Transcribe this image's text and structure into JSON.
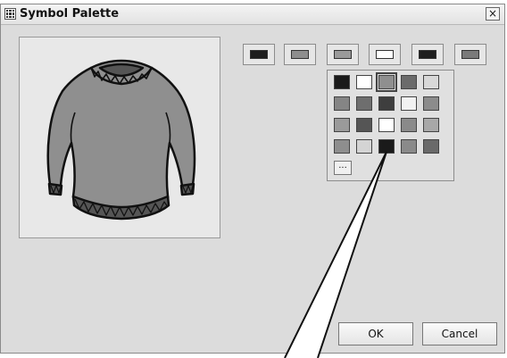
{
  "window": {
    "title": "Symbol Palette",
    "close_label": "×"
  },
  "icons": {
    "app": "grid-icon",
    "close": "close-icon"
  },
  "color_buttons": [
    {
      "color": "#1e1e1e"
    },
    {
      "color": "#8e8e8e"
    },
    {
      "color": "#9a9a9a"
    },
    {
      "color": "#ffffff"
    },
    {
      "color": "#1e1e1e"
    },
    {
      "color": "#7a7a7a"
    }
  ],
  "palette": {
    "rows": [
      [
        "#1a1a1a",
        "#ffffff",
        "#8f8f8f",
        "#6b6b6b",
        "#d8d8d8"
      ],
      [
        "#858585",
        "#6e6e6e",
        "#3e3e3e",
        "#f2f2f2",
        "#8c8c8c"
      ],
      [
        "#9a9a9a",
        "#555555",
        "#ffffff",
        "#8a8a8a",
        "#a8a8a8"
      ],
      [
        "#8e8e8e",
        "#d4d4d4",
        "#1a1a1a",
        "#8a8a8a",
        "#6a6a6a"
      ]
    ],
    "selected": {
      "row": 0,
      "col": 2
    },
    "more_label": "..."
  },
  "buttons": {
    "ok": "OK",
    "cancel": "Cancel"
  },
  "preview": {
    "image": "sweater-icon",
    "sweater_color": "#8f8f8f"
  }
}
